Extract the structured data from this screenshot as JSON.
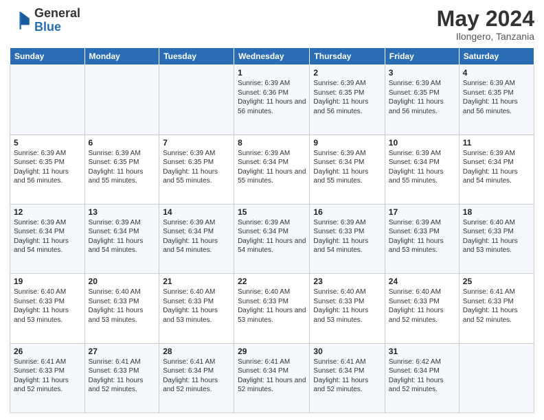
{
  "header": {
    "logo_general": "General",
    "logo_blue": "Blue",
    "month_title": "May 2024",
    "location": "Ilongero, Tanzania"
  },
  "days_of_week": [
    "Sunday",
    "Monday",
    "Tuesday",
    "Wednesday",
    "Thursday",
    "Friday",
    "Saturday"
  ],
  "weeks": [
    [
      {
        "day": "",
        "info": ""
      },
      {
        "day": "",
        "info": ""
      },
      {
        "day": "",
        "info": ""
      },
      {
        "day": "1",
        "info": "Sunrise: 6:39 AM\nSunset: 6:36 PM\nDaylight: 11 hours and 56 minutes."
      },
      {
        "day": "2",
        "info": "Sunrise: 6:39 AM\nSunset: 6:35 PM\nDaylight: 11 hours and 56 minutes."
      },
      {
        "day": "3",
        "info": "Sunrise: 6:39 AM\nSunset: 6:35 PM\nDaylight: 11 hours and 56 minutes."
      },
      {
        "day": "4",
        "info": "Sunrise: 6:39 AM\nSunset: 6:35 PM\nDaylight: 11 hours and 56 minutes."
      }
    ],
    [
      {
        "day": "5",
        "info": "Sunrise: 6:39 AM\nSunset: 6:35 PM\nDaylight: 11 hours and 56 minutes."
      },
      {
        "day": "6",
        "info": "Sunrise: 6:39 AM\nSunset: 6:35 PM\nDaylight: 11 hours and 55 minutes."
      },
      {
        "day": "7",
        "info": "Sunrise: 6:39 AM\nSunset: 6:35 PM\nDaylight: 11 hours and 55 minutes."
      },
      {
        "day": "8",
        "info": "Sunrise: 6:39 AM\nSunset: 6:34 PM\nDaylight: 11 hours and 55 minutes."
      },
      {
        "day": "9",
        "info": "Sunrise: 6:39 AM\nSunset: 6:34 PM\nDaylight: 11 hours and 55 minutes."
      },
      {
        "day": "10",
        "info": "Sunrise: 6:39 AM\nSunset: 6:34 PM\nDaylight: 11 hours and 55 minutes."
      },
      {
        "day": "11",
        "info": "Sunrise: 6:39 AM\nSunset: 6:34 PM\nDaylight: 11 hours and 54 minutes."
      }
    ],
    [
      {
        "day": "12",
        "info": "Sunrise: 6:39 AM\nSunset: 6:34 PM\nDaylight: 11 hours and 54 minutes."
      },
      {
        "day": "13",
        "info": "Sunrise: 6:39 AM\nSunset: 6:34 PM\nDaylight: 11 hours and 54 minutes."
      },
      {
        "day": "14",
        "info": "Sunrise: 6:39 AM\nSunset: 6:34 PM\nDaylight: 11 hours and 54 minutes."
      },
      {
        "day": "15",
        "info": "Sunrise: 6:39 AM\nSunset: 6:34 PM\nDaylight: 11 hours and 54 minutes."
      },
      {
        "day": "16",
        "info": "Sunrise: 6:39 AM\nSunset: 6:33 PM\nDaylight: 11 hours and 54 minutes."
      },
      {
        "day": "17",
        "info": "Sunrise: 6:39 AM\nSunset: 6:33 PM\nDaylight: 11 hours and 53 minutes."
      },
      {
        "day": "18",
        "info": "Sunrise: 6:40 AM\nSunset: 6:33 PM\nDaylight: 11 hours and 53 minutes."
      }
    ],
    [
      {
        "day": "19",
        "info": "Sunrise: 6:40 AM\nSunset: 6:33 PM\nDaylight: 11 hours and 53 minutes."
      },
      {
        "day": "20",
        "info": "Sunrise: 6:40 AM\nSunset: 6:33 PM\nDaylight: 11 hours and 53 minutes."
      },
      {
        "day": "21",
        "info": "Sunrise: 6:40 AM\nSunset: 6:33 PM\nDaylight: 11 hours and 53 minutes."
      },
      {
        "day": "22",
        "info": "Sunrise: 6:40 AM\nSunset: 6:33 PM\nDaylight: 11 hours and 53 minutes."
      },
      {
        "day": "23",
        "info": "Sunrise: 6:40 AM\nSunset: 6:33 PM\nDaylight: 11 hours and 53 minutes."
      },
      {
        "day": "24",
        "info": "Sunrise: 6:40 AM\nSunset: 6:33 PM\nDaylight: 11 hours and 52 minutes."
      },
      {
        "day": "25",
        "info": "Sunrise: 6:41 AM\nSunset: 6:33 PM\nDaylight: 11 hours and 52 minutes."
      }
    ],
    [
      {
        "day": "26",
        "info": "Sunrise: 6:41 AM\nSunset: 6:33 PM\nDaylight: 11 hours and 52 minutes."
      },
      {
        "day": "27",
        "info": "Sunrise: 6:41 AM\nSunset: 6:33 PM\nDaylight: 11 hours and 52 minutes."
      },
      {
        "day": "28",
        "info": "Sunrise: 6:41 AM\nSunset: 6:34 PM\nDaylight: 11 hours and 52 minutes."
      },
      {
        "day": "29",
        "info": "Sunrise: 6:41 AM\nSunset: 6:34 PM\nDaylight: 11 hours and 52 minutes."
      },
      {
        "day": "30",
        "info": "Sunrise: 6:41 AM\nSunset: 6:34 PM\nDaylight: 11 hours and 52 minutes."
      },
      {
        "day": "31",
        "info": "Sunrise: 6:42 AM\nSunset: 6:34 PM\nDaylight: 11 hours and 52 minutes."
      },
      {
        "day": "",
        "info": ""
      }
    ]
  ]
}
